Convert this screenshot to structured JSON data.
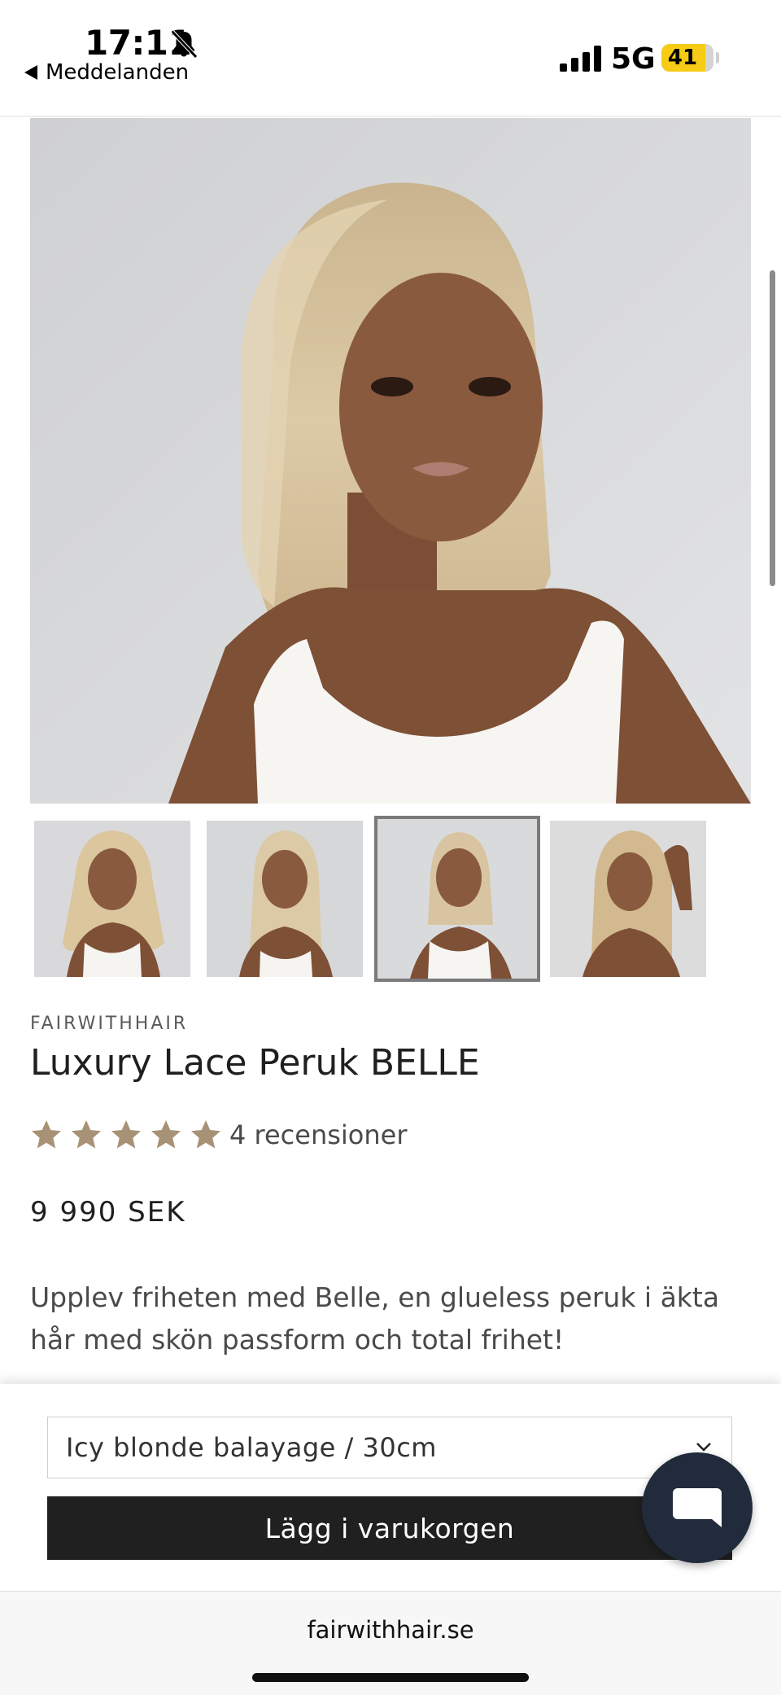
{
  "status_bar": {
    "time": "17:11",
    "back_label": "Meddelanden",
    "network": "5G",
    "battery": "41",
    "battery_level": 0.41,
    "battery_color": "#f6cc16"
  },
  "gallery": {
    "main_image_alt": "Luxury Lace Peruk BELLE – main photo",
    "thumbnails": [
      {
        "alt": "Wavy blonde style",
        "selected": false
      },
      {
        "alt": "Long straight blonde style",
        "selected": false
      },
      {
        "alt": "Shoulder-length blonde style",
        "selected": true
      },
      {
        "alt": "Hand in hair blonde style",
        "selected": false
      }
    ]
  },
  "product": {
    "brand": "FAIRWITHHAIR",
    "title": "Luxury Lace Peruk BELLE",
    "rating": 5,
    "rating_max": 5,
    "star_color": "#a89276",
    "reviews": "4 recensioner",
    "price": "9 990 SEK",
    "description": "Upplev friheten med Belle, en glueless peruk i äkta hår med skön passform och total frihet!"
  },
  "purchase": {
    "variant_value": "Icy blonde balayage / 30cm",
    "add_to_cart_label": "Lägg i varukorgen",
    "chat_icon": "chat-bubble-icon"
  },
  "browser": {
    "url": "fairwithhair.se"
  }
}
